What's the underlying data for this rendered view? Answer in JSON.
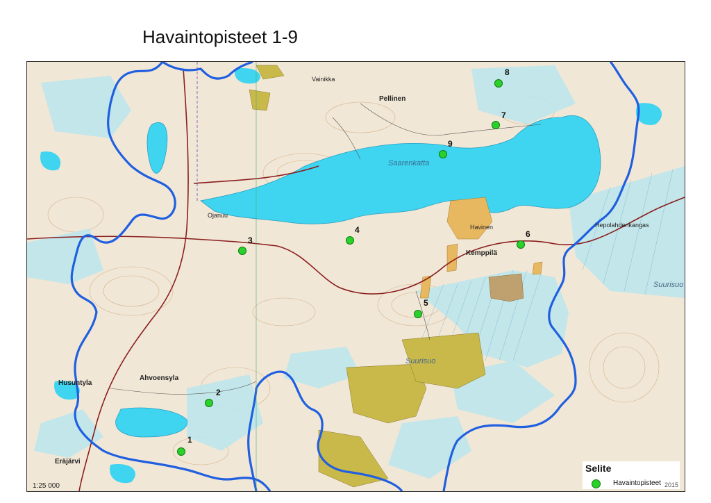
{
  "title": "Havaintopisteet 1-9",
  "points": [
    {
      "label": "1"
    },
    {
      "label": "2"
    },
    {
      "label": "3"
    },
    {
      "label": "4"
    },
    {
      "label": "5"
    },
    {
      "label": "6"
    },
    {
      "label": "7"
    },
    {
      "label": "8"
    },
    {
      "label": "9"
    }
  ],
  "places": {
    "pellinen": "Pellinen",
    "saarenkatta": "Saarenkatta",
    "kemppila": "Kemppilä",
    "suurisuo_center": "Suurisuo",
    "suurisuo_east": "Suurisuo",
    "husuntyla": "Husuntyla",
    "ahvoensyla": "Ahvoensyla",
    "erajarvi": "Eräjärvi",
    "hepolahdenkangas": "Hepolahdenkangas",
    "ojanuu": "Ojanuu",
    "havinen": "Havinen",
    "vainikka": "Vainikka"
  },
  "legend": {
    "title": "Selite",
    "item_label": "Havaintopisteet"
  },
  "scale": "1:25 000",
  "copyright": "2015",
  "colors": {
    "water": "#3fd4f0",
    "land": "#f1e7d6",
    "marsh": "#bde6ec",
    "boundary": "#1f5fe0",
    "field": "#c9b84a",
    "settlement": "#e8b860",
    "road": "#8a1d1d",
    "point": "#2bd12b"
  },
  "icons": [
    "observation-point-icon"
  ]
}
